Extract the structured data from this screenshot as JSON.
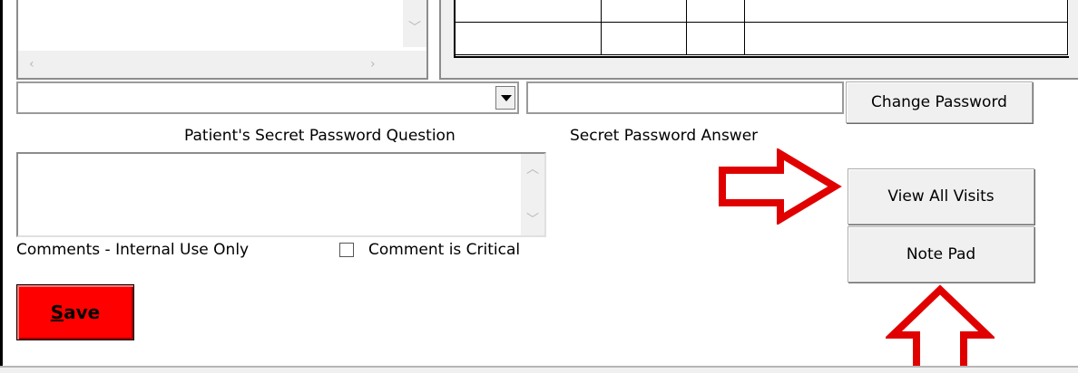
{
  "dropdown": {
    "selected": ""
  },
  "answer_field": {
    "value": ""
  },
  "buttons": {
    "change_password": "Change Password",
    "view_all_visits": "View All Visits",
    "note_pad": "Note Pad",
    "save_prefix": "S",
    "save_rest": "ave"
  },
  "labels": {
    "secret_question": "Patient's Secret Password Question",
    "secret_answer": "Secret Password Answer",
    "comments": "Comments - Internal Use Only",
    "comment_critical": "Comment is Critical"
  },
  "comments_box": {
    "value": ""
  },
  "checkbox": {
    "checked": false
  },
  "annotations": {
    "arrow_color": "#e00000",
    "save_color": "#ff0000"
  },
  "icons": [
    "chevron-down-icon",
    "chevron-left-icon",
    "chevron-right-icon",
    "chevron-up-icon",
    "dropdown-arrow-icon",
    "arrow-right-annotation",
    "arrow-up-annotation"
  ]
}
